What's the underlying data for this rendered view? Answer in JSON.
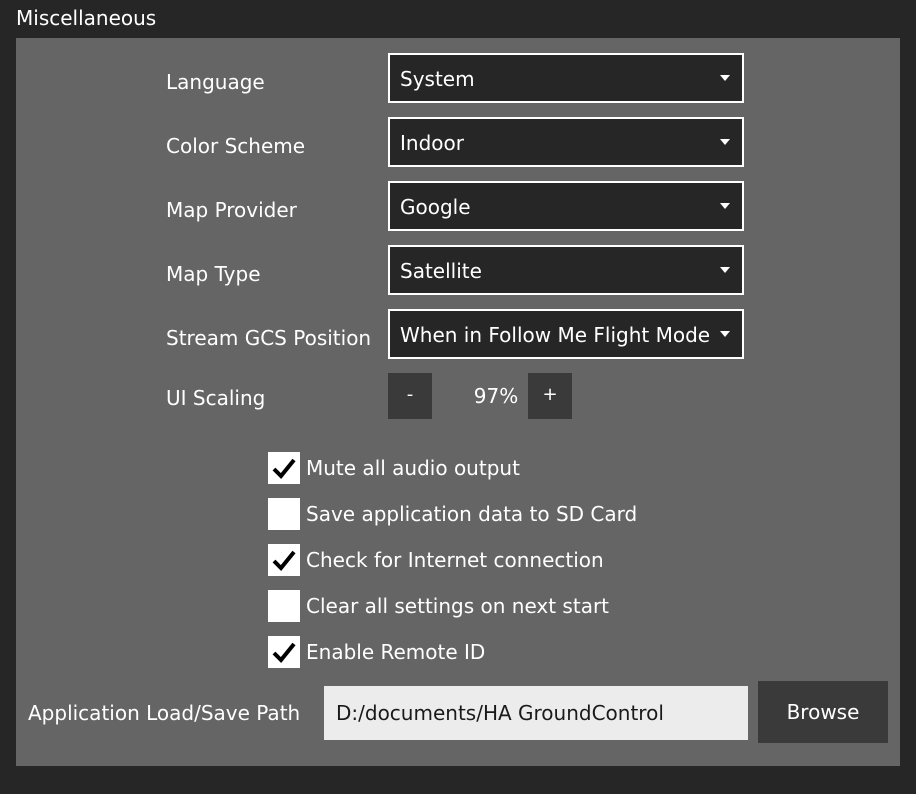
{
  "section": {
    "title": "Miscellaneous"
  },
  "settings": {
    "language": {
      "label": "Language",
      "value": "System"
    },
    "color_scheme": {
      "label": "Color Scheme",
      "value": "Indoor"
    },
    "map_provider": {
      "label": "Map Provider",
      "value": "Google"
    },
    "map_type": {
      "label": "Map Type",
      "value": "Satellite"
    },
    "stream_gcs_position": {
      "label": "Stream GCS Position",
      "value": "When in Follow Me Flight Mode"
    }
  },
  "ui_scaling": {
    "label": "UI Scaling",
    "decrease_label": "-",
    "value": "97%",
    "increase_label": "+"
  },
  "checkboxes": [
    {
      "label": "Mute all audio output",
      "checked": true
    },
    {
      "label": "Save application data to SD Card",
      "checked": false
    },
    {
      "label": "Check for Internet connection",
      "checked": true
    },
    {
      "label": "Clear all settings on next start",
      "checked": false
    },
    {
      "label": "Enable Remote ID",
      "checked": true
    }
  ],
  "app_path": {
    "label": "Application Load/Save Path",
    "value": "D:/documents/HA GroundControl",
    "browse_label": "Browse"
  },
  "colors": {
    "background": "#262626",
    "panel": "#656565",
    "combo_background": "#262626",
    "button_background": "#3a3a3a",
    "input_background": "#ececec"
  },
  "icons": {
    "dropdown": "chevron-down-icon",
    "check": "checkmark-icon"
  }
}
